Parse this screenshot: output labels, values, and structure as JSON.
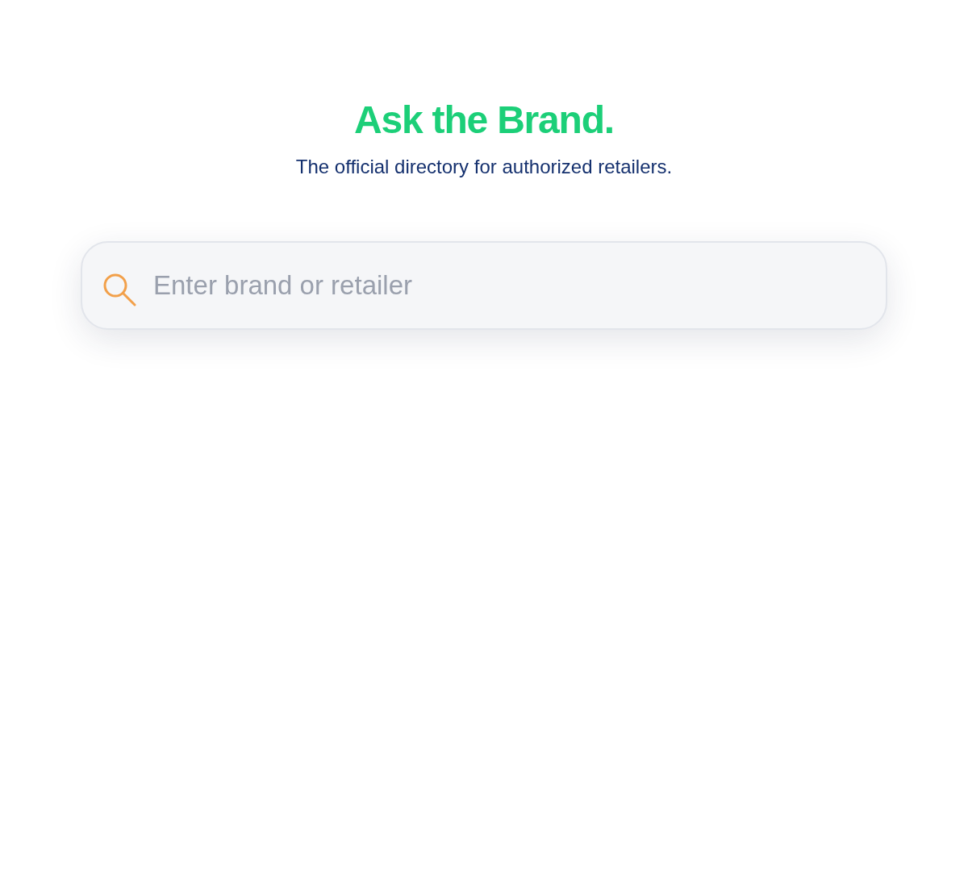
{
  "header": {
    "title": "Ask the Brand.",
    "subtitle": "The official directory for authorized retailers."
  },
  "search": {
    "placeholder": "Enter brand or retailer"
  }
}
